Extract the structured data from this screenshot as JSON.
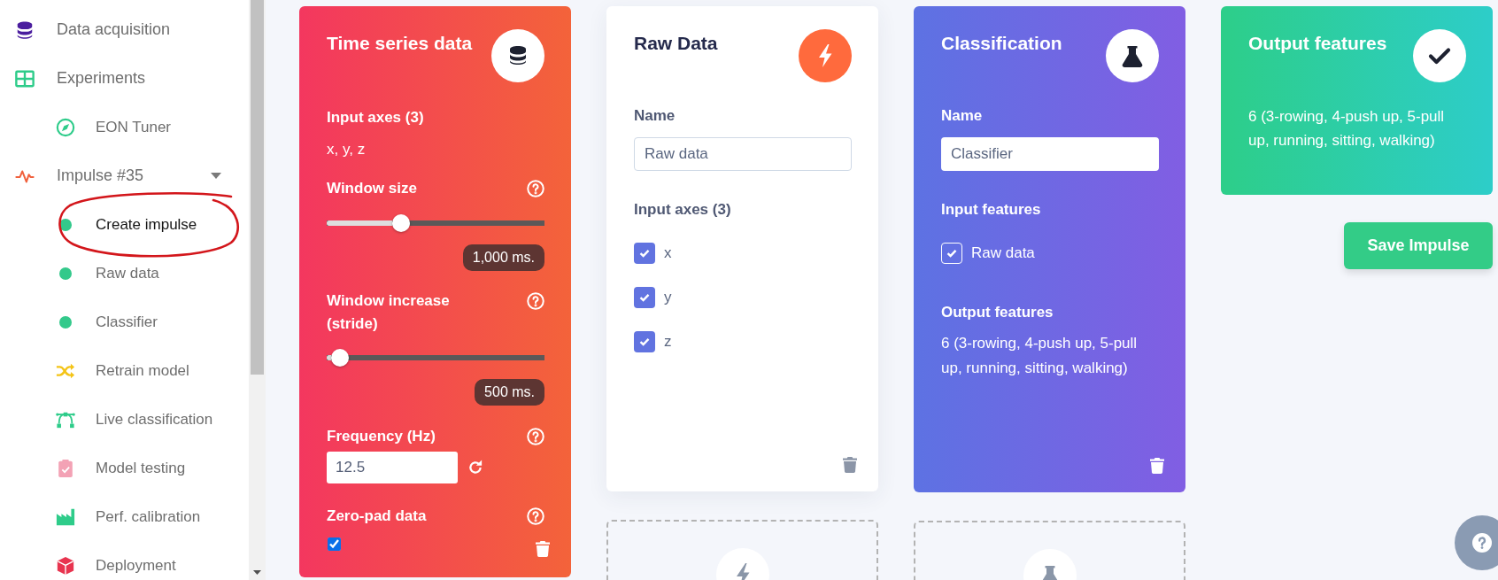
{
  "sidebar": {
    "items": [
      {
        "label": "Data acquisition",
        "kind": "database",
        "selected": false
      },
      {
        "label": "Experiments",
        "kind": "table",
        "selected": false,
        "children": [
          {
            "label": "EON Tuner",
            "kind": "compass",
            "selected": false
          }
        ]
      },
      {
        "label": "Impulse #35",
        "kind": "pulse",
        "selected": false,
        "expanded": true,
        "children": [
          {
            "label": "Create impulse",
            "kind": "step",
            "selected": true
          },
          {
            "label": "Raw data",
            "kind": "step",
            "selected": false
          },
          {
            "label": "Classifier",
            "kind": "step",
            "selected": false
          },
          {
            "label": "Retrain model",
            "kind": "shuffle",
            "selected": false
          },
          {
            "label": "Live classification",
            "kind": "curve",
            "selected": false
          },
          {
            "label": "Model testing",
            "kind": "clipboard",
            "selected": false
          },
          {
            "label": "Perf. calibration",
            "kind": "factory",
            "selected": false
          },
          {
            "label": "Deployment",
            "kind": "cube",
            "selected": false
          }
        ]
      }
    ]
  },
  "time_series": {
    "title": "Time series data",
    "axes_label": "Input axes (3)",
    "axes": "x, y, z",
    "sliders": [
      {
        "label": "Window size",
        "level": 0.34,
        "reading": "1,000 ms."
      },
      {
        "label": "Window increase (stride)",
        "level": 0.06,
        "reading": "500 ms."
      }
    ],
    "frequency": {
      "label": "Frequency (Hz)",
      "value": "12.5"
    },
    "zero_pad": {
      "label": "Zero-pad data",
      "checked": true
    }
  },
  "raw_data": {
    "title": "Raw Data",
    "name_label": "Name",
    "name_value": "Raw data",
    "axes_label": "Input axes (3)",
    "axes": [
      {
        "label": "x",
        "checked": true
      },
      {
        "label": "y",
        "checked": true
      },
      {
        "label": "z",
        "checked": true
      }
    ]
  },
  "classification": {
    "title": "Classification",
    "name_label": "Name",
    "name_value": "Classifier",
    "inputs_label": "Input features",
    "inputs": [
      {
        "label": "Raw data",
        "checked": true
      }
    ],
    "outputs_label": "Output features",
    "outputs": "6 (3-rowing, 4-push up, 5-pull up, running, sitting, walking)"
  },
  "output_features": {
    "title": "Output features",
    "text": "6 (3-rowing, 4-push up, 5-pull up, running, sitting, walking)"
  },
  "save_button": {
    "label": "Save Impulse"
  }
}
